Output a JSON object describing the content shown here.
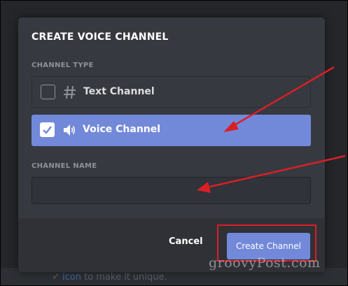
{
  "dialog": {
    "title": "CREATE VOICE CHANNEL",
    "channel_type_label": "CHANNEL TYPE",
    "options": [
      {
        "label": "Text Channel",
        "icon": "hash-icon",
        "checked": false
      },
      {
        "label": "Voice Channel",
        "icon": "speaker-icon",
        "checked": true
      }
    ],
    "channel_name_label": "CHANNEL NAME",
    "channel_name_value": "",
    "cancel_label": "Cancel",
    "create_label": "Create Channel"
  },
  "background": {
    "hint_link": "icon",
    "hint_text": " to make it unique."
  },
  "watermark": "groovyPost.com",
  "colors": {
    "accent": "#7289da",
    "dialog_bg": "#36393f",
    "footer_bg": "#2f3136",
    "annotation_red": "#d91f26"
  }
}
